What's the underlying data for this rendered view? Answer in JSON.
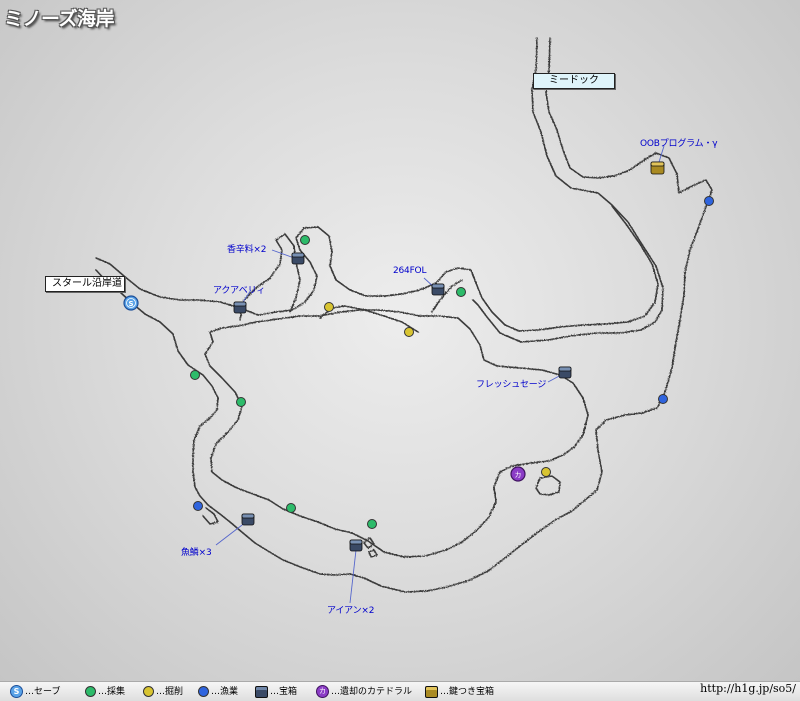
{
  "title": "ミノーズ海岸",
  "areas": [
    {
      "id": "mi-dokku",
      "name": "ミードック"
    },
    {
      "id": "staaru",
      "name": "スタール沿岸道"
    }
  ],
  "item_labels": [
    {
      "id": "oob",
      "text": "OOBプログラム・γ"
    },
    {
      "id": "koushinryou",
      "text": "香辛料×2"
    },
    {
      "id": "fol",
      "text": "264FOL"
    },
    {
      "id": "acquaberry",
      "text": "アクアベリィ"
    },
    {
      "id": "fresh",
      "text": "フレッシュセージ"
    },
    {
      "id": "gyorin",
      "text": "魚鱗×3"
    },
    {
      "id": "iron",
      "text": "アイアン×2"
    }
  ],
  "legend": [
    {
      "icon": "save-icon",
      "glyph": "S",
      "label": "…セーブ",
      "color": "#5aa3e8"
    },
    {
      "icon": "gather-icon",
      "label": "…採集",
      "color": "#2dbb6a"
    },
    {
      "icon": "mining-icon",
      "label": "…掘削",
      "color": "#d8c431"
    },
    {
      "icon": "fishing-icon",
      "label": "…漁業",
      "color": "#2f64de"
    },
    {
      "icon": "chest-icon",
      "label": "…宝箱",
      "color": "#3a4a66"
    },
    {
      "icon": "cathedral-icon",
      "glyph": "カ",
      "label": "…遺却のカテドラル",
      "color": "#8b3cc6"
    },
    {
      "icon": "locked-chest-icon",
      "label": "…鍵つき宝箱",
      "color": "#a98a22"
    }
  ],
  "site_url": "http://h1g.jp/so5/",
  "colors": {
    "gather": "#2dbb6a",
    "mining": "#d8c431",
    "fishing": "#2f64de",
    "save": "#5aa3e8",
    "cathedral": "#8b3cc6",
    "chest": "#3a4a66",
    "locked_chest": "#a98a22",
    "item_label_text": "#0000cc"
  }
}
